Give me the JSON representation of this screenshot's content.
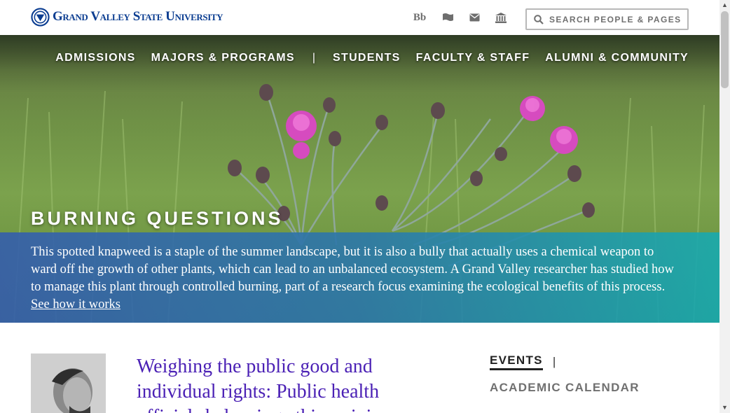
{
  "header": {
    "logo_text": "Grand Valley State University",
    "utility_icons": [
      {
        "name": "blackboard-icon",
        "label": "Bb"
      },
      {
        "name": "flag-icon"
      },
      {
        "name": "envelope-icon"
      },
      {
        "name": "institution-icon"
      }
    ],
    "search_placeholder": "SEARCH PEOPLE & PAGES"
  },
  "nav": {
    "items": [
      "ADMISSIONS",
      "MAJORS & PROGRAMS",
      "STUDENTS",
      "FACULTY & STAFF",
      "ALUMNI & COMMUNITY"
    ],
    "separator": "|"
  },
  "hero": {
    "title": "BURNING QUESTIONS",
    "caption": "This spotted knapweed is a staple of the summer landscape, but it is also a bully that actually uses a chemical weapon to ward off the growth of other plants, which can lead to an unbalanced ecosystem. A Grand Valley researcher has studied how to manage this plant through controlled burning, part of a research focus examining the ecological benefits of this process.",
    "link": "See how it works"
  },
  "news": {
    "title": "Weighing the public good and individual rights: Public health officials balancing ethics, civic"
  },
  "events": {
    "tab_events": "EVENTS",
    "separator": "|",
    "tab_academic": "ACADEMIC CALENDAR"
  },
  "colors": {
    "brand_blue": "#0b3d91",
    "link_purple": "#4b21b5",
    "caption_start": "#365faa",
    "caption_end": "#18aaaf"
  }
}
